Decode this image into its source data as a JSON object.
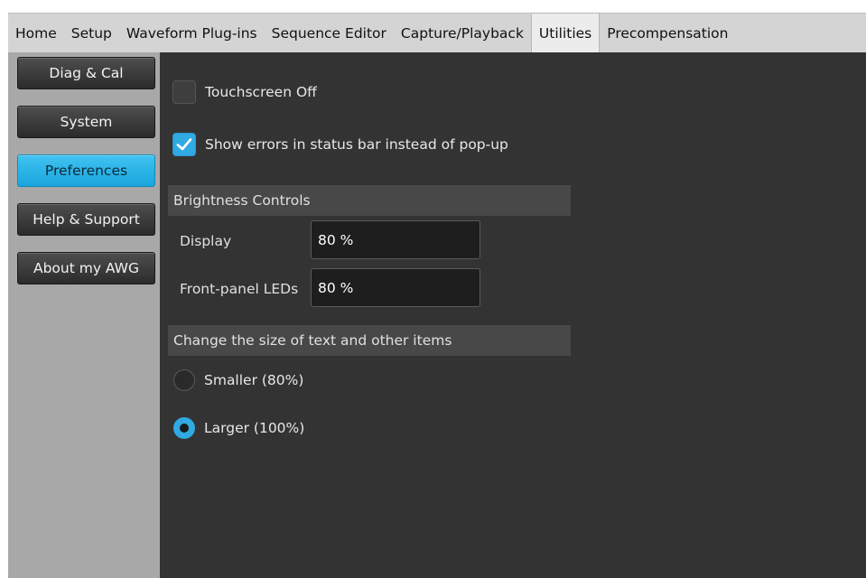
{
  "tabs": [
    {
      "label": "Home",
      "active": false
    },
    {
      "label": "Setup",
      "active": false
    },
    {
      "label": "Waveform Plug-ins",
      "active": false
    },
    {
      "label": "Sequence Editor",
      "active": false
    },
    {
      "label": "Capture/Playback",
      "active": false
    },
    {
      "label": "Utilities",
      "active": true
    },
    {
      "label": "Precompensation",
      "active": false
    }
  ],
  "sidebar": {
    "items": [
      {
        "label": "Diag & Cal",
        "active": false
      },
      {
        "label": "System",
        "active": false
      },
      {
        "label": "Preferences",
        "active": true
      },
      {
        "label": "Help & Support",
        "active": false
      },
      {
        "label": "About my AWG",
        "active": false
      }
    ]
  },
  "preferences": {
    "touchscreen_off": {
      "label": "Touchscreen Off",
      "checked": false
    },
    "show_errors": {
      "label": "Show errors in status bar instead of pop-up",
      "checked": true
    },
    "brightness": {
      "header": "Brightness Controls",
      "display_label": "Display",
      "display_value": "80 %",
      "leds_label": "Front-panel LEDs",
      "leds_value": "80 %"
    },
    "text_size": {
      "header": "Change the size of text and other items",
      "options": [
        {
          "label": "Smaller (80%)",
          "selected": false
        },
        {
          "label": "Larger (100%)",
          "selected": true
        }
      ]
    }
  },
  "colors": {
    "accent": "#31a9e3",
    "content_bg": "#333333",
    "sidebar_bg": "#a8a8a8",
    "tabbar_bg": "#d4d4d4"
  }
}
